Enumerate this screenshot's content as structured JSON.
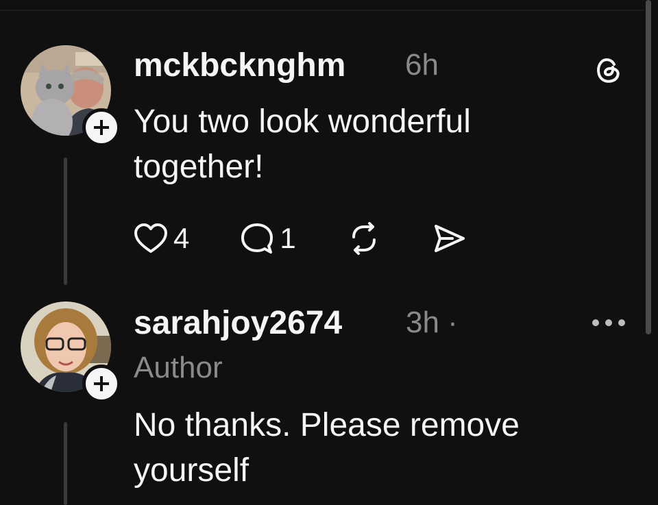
{
  "posts": [
    {
      "username": "mckbcknghm",
      "time": "6h",
      "text_line1": "You two look wonderful",
      "text_line2": "together!",
      "avatar_icon": "avatar-man-with-cat",
      "likes": "4",
      "replies": "1"
    },
    {
      "username": "sarahjoy2674",
      "time": "3h ·",
      "author_tag": "Author",
      "text_line1": "No thanks. Please remove",
      "text_line2": "yourself",
      "avatar_icon": "avatar-woman-with-glasses"
    }
  ],
  "colors": {
    "background": "#101010",
    "text": "#f3f5f7",
    "muted": "#8a8a8a",
    "line": "#3a3a3a"
  }
}
